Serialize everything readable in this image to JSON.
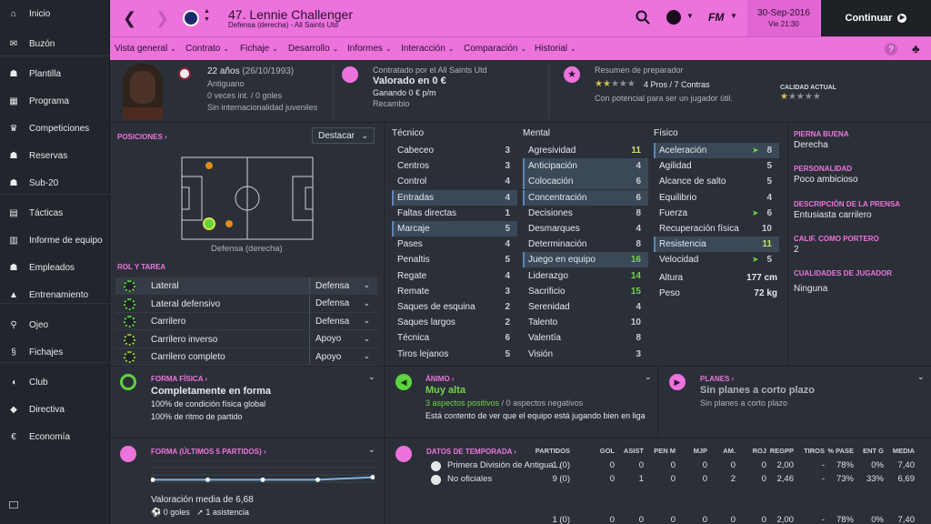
{
  "sidebar": {
    "items": [
      {
        "label": "Inicio",
        "icon": "home-icon"
      },
      {
        "label": "Buzón",
        "icon": "inbox-icon"
      },
      {
        "label": "Plantilla",
        "icon": "squad-icon"
      },
      {
        "label": "Programa",
        "icon": "calendar-icon"
      },
      {
        "label": "Competiciones",
        "icon": "trophy-icon"
      },
      {
        "label": "Reservas",
        "icon": "reserves-icon"
      },
      {
        "label": "Sub-20",
        "icon": "u20-icon"
      },
      {
        "label": "Tácticas",
        "icon": "tactics-icon"
      },
      {
        "label": "Informe de equipo",
        "icon": "report-icon"
      },
      {
        "label": "Empleados",
        "icon": "staff-icon"
      },
      {
        "label": "Entrenamiento",
        "icon": "training-icon"
      },
      {
        "label": "Ojeo",
        "icon": "scouting-icon"
      },
      {
        "label": "Fichajes",
        "icon": "transfers-icon"
      },
      {
        "label": "Club",
        "icon": "club-icon"
      },
      {
        "label": "Directiva",
        "icon": "board-icon"
      },
      {
        "label": "Economía",
        "icon": "finance-icon"
      }
    ]
  },
  "header": {
    "title": "47. Lennie Challenger",
    "subtitle": "Defensa (derecha) - All Saints Utd",
    "date": "30-Sep-2016",
    "time": "Vie 21:30",
    "continue": "Continuar",
    "fm": "FM"
  },
  "nav": {
    "items": [
      "Vista general",
      "Contrato",
      "Fichaje",
      "Desarrollo",
      "Informes",
      "Interacción",
      "Comparación",
      "Historial"
    ]
  },
  "profile": {
    "age": "22 años",
    "dob": "(26/10/1993)",
    "nationality": "Antiguano",
    "caps": "0 veces int. / 0 goles",
    "youth": "Sin internacionalidad juveniles",
    "contract": "Contratado por el All Saints Utd",
    "value": "Valorado en 0 €",
    "wage": "Ganando 0 € p/m",
    "wage_extra": "Recambio",
    "coach_title": "Resumen de preparador",
    "pros_cons": "4 Pros / 7 Contras",
    "potential": "Con potencial para ser un jugador útil.",
    "current": "CALIDAD ACTUAL"
  },
  "positions": {
    "title": "POSICIONES",
    "dropdown": "Destacar",
    "caption": "Defensa (derecha)"
  },
  "roles": {
    "title": "ROL Y TAREA",
    "items": [
      {
        "name": "Lateral",
        "duty": "Defensa"
      },
      {
        "name": "Lateral defensivo",
        "duty": "Defensa"
      },
      {
        "name": "Carrilero",
        "duty": "Defensa"
      },
      {
        "name": "Carrilero inverso",
        "duty": "Apoyo"
      },
      {
        "name": "Carrilero completo",
        "duty": "Apoyo"
      }
    ]
  },
  "technical": {
    "title": "Técnico",
    "items": [
      {
        "n": "Cabeceo",
        "v": "3"
      },
      {
        "n": "Centros",
        "v": "3"
      },
      {
        "n": "Control",
        "v": "4"
      },
      {
        "n": "Entradas",
        "v": "4"
      },
      {
        "n": "Faltas directas",
        "v": "1"
      },
      {
        "n": "Marcaje",
        "v": "5"
      },
      {
        "n": "Pases",
        "v": "4"
      },
      {
        "n": "Penaltis",
        "v": "5"
      },
      {
        "n": "Regate",
        "v": "4"
      },
      {
        "n": "Remate",
        "v": "3"
      },
      {
        "n": "Saques de esquina",
        "v": "2"
      },
      {
        "n": "Saques largos",
        "v": "2"
      },
      {
        "n": "Técnica",
        "v": "6"
      },
      {
        "n": "Tiros lejanos",
        "v": "5"
      }
    ]
  },
  "mental": {
    "title": "Mental",
    "items": [
      {
        "n": "Agresividad",
        "v": "11"
      },
      {
        "n": "Anticipación",
        "v": "4"
      },
      {
        "n": "Colocación",
        "v": "6"
      },
      {
        "n": "Concentración",
        "v": "6"
      },
      {
        "n": "Decisiones",
        "v": "8"
      },
      {
        "n": "Desmarques",
        "v": "4"
      },
      {
        "n": "Determinación",
        "v": "8"
      },
      {
        "n": "Juego en equipo",
        "v": "16"
      },
      {
        "n": "Liderazgo",
        "v": "14"
      },
      {
        "n": "Sacrificio",
        "v": "15"
      },
      {
        "n": "Serenidad",
        "v": "4"
      },
      {
        "n": "Talento",
        "v": "10"
      },
      {
        "n": "Valentía",
        "v": "8"
      },
      {
        "n": "Visión",
        "v": "3"
      }
    ]
  },
  "physical": {
    "title": "Físico",
    "items": [
      {
        "n": "Aceleración",
        "v": "8"
      },
      {
        "n": "Agilidad",
        "v": "5"
      },
      {
        "n": "Alcance de salto",
        "v": "5"
      },
      {
        "n": "Equilibrio",
        "v": "4"
      },
      {
        "n": "Fuerza",
        "v": "6"
      },
      {
        "n": "Recuperación física",
        "v": "10"
      },
      {
        "n": "Resistencia",
        "v": "11"
      },
      {
        "n": "Velocidad",
        "v": "5"
      }
    ],
    "height_label": "Altura",
    "height": "177 cm",
    "weight_label": "Peso",
    "weight": "72 kg"
  },
  "info": {
    "foot_label": "PIERNA BUENA",
    "foot": "Derecha",
    "pers_label": "PERSONALIDAD",
    "pers": "Poco ambicioso",
    "press_label": "DESCRIPCIÓN DE LA PRENSA",
    "press": "Entusiasta carrilero",
    "gk_label": "CALIF. COMO PORTERO",
    "gk": "2",
    "qual_label": "CUALIDADES DE JUGADOR",
    "qual": "Ninguna"
  },
  "fitness": {
    "label": "FORMA FÍSICA",
    "status": "Completamente en forma",
    "l1": "100% de condición física global",
    "l2": "100% de ritmo de partido"
  },
  "morale": {
    "label": "ÁNIMO",
    "status": "Muy alta",
    "pos": "3 aspectos positivos",
    "sep": "/",
    "neg": "0 aspectos negativos",
    "desc": "Está contento de ver que el equipo está jugando bien en liga"
  },
  "plans": {
    "label": "PLANES",
    "status": "Sin planes a corto plazo",
    "desc": "Sin planes a corto plazo"
  },
  "form": {
    "label": "FORMA (ÚLTIMOS 5 PARTIDOS)",
    "avg": "Valoración media de 6,68",
    "goals": "0 goles",
    "assists": "1 asistencia",
    "ratings": [
      6.7,
      6.7,
      6.7,
      6.7,
      6.8
    ]
  },
  "season": {
    "label": "DATOS DE TEMPORADA",
    "headers": [
      "PARTIDOS",
      "GOL",
      "ASIST",
      "PEN M",
      "MJP",
      "AM.",
      "ROJ",
      "REGPP",
      "TIROS",
      "% PASE",
      "ENT G",
      "MEDIA"
    ],
    "rows": [
      {
        "name": "Primera División de Antigua...",
        "cells": [
          "1 (0)",
          "0",
          "0",
          "0",
          "0",
          "0",
          "0",
          "2,00",
          "-",
          "78%",
          "0%",
          "7,40"
        ]
      },
      {
        "name": "No oficiales",
        "cells": [
          "9 (0)",
          "0",
          "1",
          "0",
          "0",
          "2",
          "0",
          "2,46",
          "-",
          "73%",
          "33%",
          "6,69"
        ]
      },
      {
        "name": "",
        "cells": [
          "1 (0)",
          "0",
          "0",
          "0",
          "0",
          "0",
          "0",
          "2,00",
          "-",
          "78%",
          "0%",
          "7,40"
        ]
      }
    ]
  },
  "colors": {
    "accent": "#ec72dc",
    "green": "#73d24d",
    "highlight": "#3a4858"
  }
}
